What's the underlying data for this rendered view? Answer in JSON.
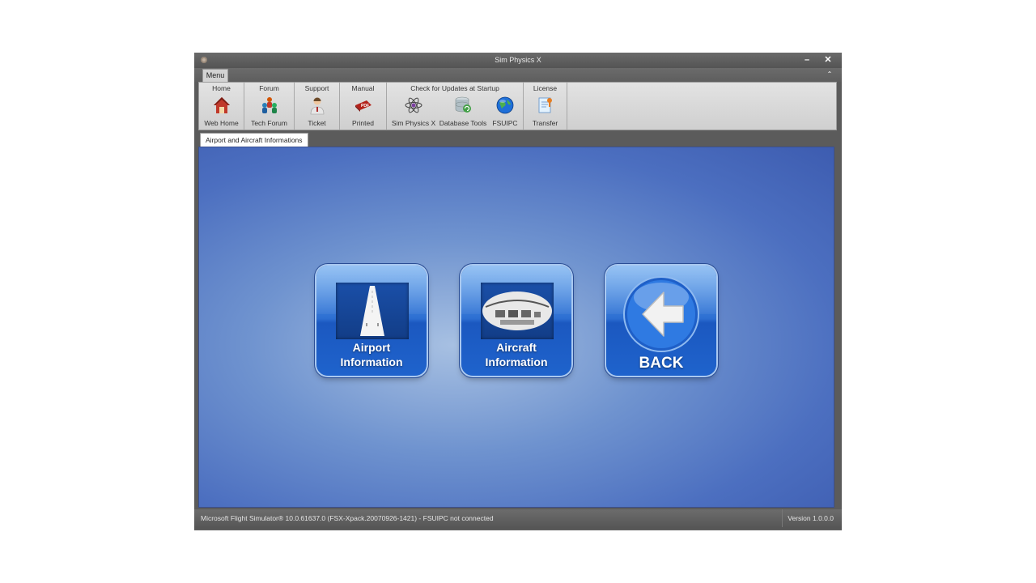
{
  "window": {
    "title": "Sim Physics X",
    "minimize": "–",
    "close": "✕"
  },
  "ribbon": {
    "menu_tab": "Menu",
    "collapse": "⌃",
    "groups": [
      {
        "title": "Home",
        "buttons": [
          {
            "label": "Web Home",
            "icon": "house-icon"
          }
        ]
      },
      {
        "title": "Forum",
        "buttons": [
          {
            "label": "Tech Forum",
            "icon": "users-icon"
          }
        ]
      },
      {
        "title": "Support",
        "buttons": [
          {
            "label": "Ticket",
            "icon": "support-person-icon"
          }
        ]
      },
      {
        "title": "Manual",
        "buttons": [
          {
            "label": "Printed",
            "icon": "pdf-book-icon"
          }
        ]
      },
      {
        "title": "Check for Updates at Startup",
        "buttons": [
          {
            "label": "Sim Physics X",
            "icon": "atom-icon"
          },
          {
            "label": "Database Tools",
            "icon": "database-icon"
          },
          {
            "label": "FSUIPC",
            "icon": "globe-icon"
          }
        ]
      },
      {
        "title": "License",
        "buttons": [
          {
            "label": "Transfer",
            "icon": "license-transfer-icon"
          }
        ]
      }
    ]
  },
  "document_tab": "Airport and Aircraft Informations",
  "tiles": {
    "airport": {
      "line1": "Airport",
      "line2": "Information"
    },
    "aircraft": {
      "line1": "Aircraft",
      "line2": "Information"
    },
    "back": {
      "label": "BACK"
    }
  },
  "status": {
    "left": "Microsoft Flight Simulator® 10.0.61637.0 (FSX-Xpack.20070926-1421)   -  FSUIPC not connected",
    "right": "Version 1.0.0.0"
  },
  "colors": {
    "content_center": "#a7c0e2",
    "content_edge": "#3d5cb0",
    "tile_blue": "#2d6fd2"
  }
}
